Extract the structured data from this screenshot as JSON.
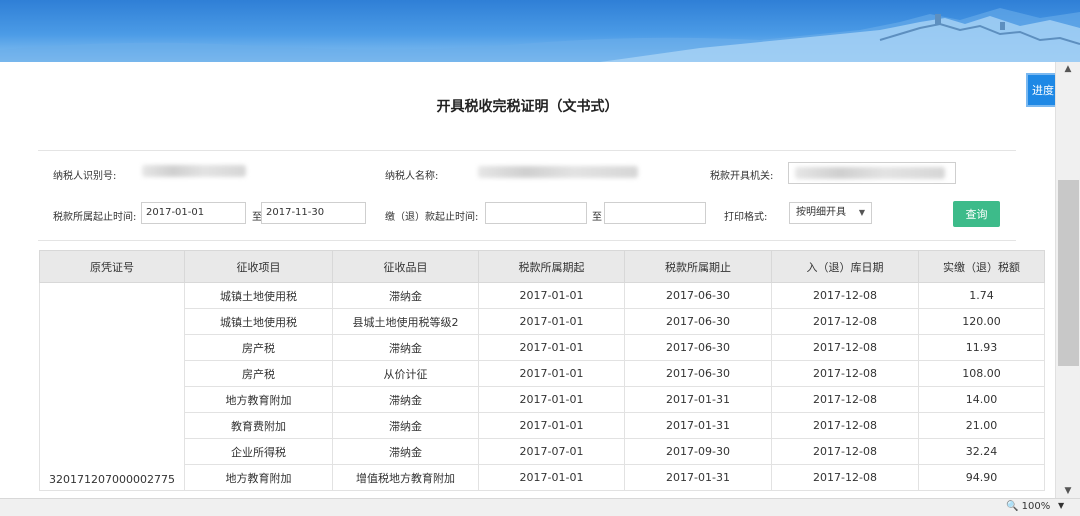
{
  "title": "开具税收完税证明（文书式）",
  "progress_button": "进度",
  "form": {
    "taxpayer_id_label": "纳税人识别号:",
    "taxpayer_name_label": "纳税人名称:",
    "tax_authority_label": "税款开具机关:",
    "tax_period_label": "税款所属起止时间:",
    "tax_period_start": "2017-01-01",
    "to_label": "至",
    "tax_period_end": "2017-11-30",
    "payment_period_label": "缴（退）款起止时间:",
    "payment_period_start": "",
    "payment_period_end": "",
    "print_format_label": "打印格式:",
    "print_format_value": "按明细开具",
    "query_button": "查询"
  },
  "table": {
    "columns": [
      "原凭证号",
      "征收项目",
      "征收品目",
      "税款所属期起",
      "税款所属期止",
      "入（退）库日期",
      "实缴（退）税额"
    ],
    "voucher": "320171207000002775",
    "rows": [
      {
        "item": "城镇土地使用税",
        "sub": "滞纳金",
        "start": "2017-01-01",
        "end": "2017-06-30",
        "date": "2017-12-08",
        "amount": "1.74"
      },
      {
        "item": "城镇土地使用税",
        "sub": "县城土地使用税等级2",
        "start": "2017-01-01",
        "end": "2017-06-30",
        "date": "2017-12-08",
        "amount": "120.00"
      },
      {
        "item": "房产税",
        "sub": "滞纳金",
        "start": "2017-01-01",
        "end": "2017-06-30",
        "date": "2017-12-08",
        "amount": "11.93"
      },
      {
        "item": "房产税",
        "sub": "从价计征",
        "start": "2017-01-01",
        "end": "2017-06-30",
        "date": "2017-12-08",
        "amount": "108.00"
      },
      {
        "item": "地方教育附加",
        "sub": "滞纳金",
        "start": "2017-01-01",
        "end": "2017-01-31",
        "date": "2017-12-08",
        "amount": "14.00"
      },
      {
        "item": "教育费附加",
        "sub": "滞纳金",
        "start": "2017-01-01",
        "end": "2017-01-31",
        "date": "2017-12-08",
        "amount": "21.00"
      },
      {
        "item": "企业所得税",
        "sub": "滞纳金",
        "start": "2017-07-01",
        "end": "2017-09-30",
        "date": "2017-12-08",
        "amount": "32.24"
      },
      {
        "item": "地方教育附加",
        "sub": "增值税地方教育附加",
        "start": "2017-01-01",
        "end": "2017-01-31",
        "date": "2017-12-08",
        "amount": "94.90"
      }
    ]
  },
  "status": {
    "zoom": "100%"
  }
}
